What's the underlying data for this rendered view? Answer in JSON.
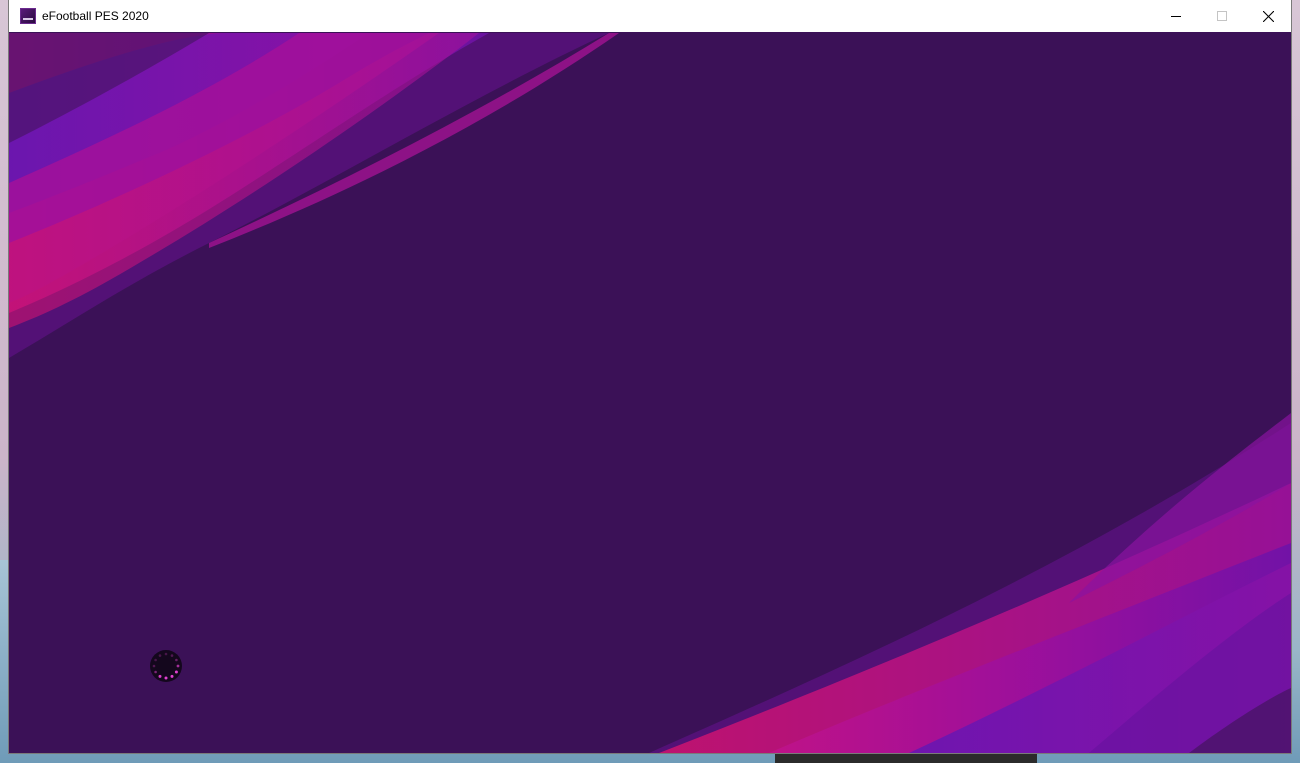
{
  "window": {
    "title": "eFootball PES 2020",
    "icon": "efootball-app-icon",
    "controls": {
      "minimize_icon": "minimize-icon",
      "maximize_icon": "maximize-icon",
      "close_icon": "close-icon"
    }
  },
  "content": {
    "background_color": "#3b1157",
    "accent_colors": [
      "#a0119b",
      "#7d0f8f",
      "#5b14b8",
      "#d0136e"
    ],
    "loading_indicator": {
      "icon": "loading-spinner-icon",
      "dot_color": "#e040d0"
    }
  }
}
